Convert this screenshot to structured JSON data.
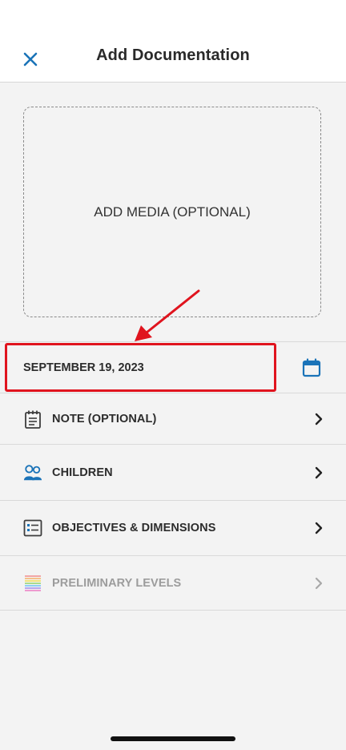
{
  "header": {
    "title": "Add Documentation",
    "close_icon": "close-icon"
  },
  "media": {
    "label": "ADD MEDIA (OPTIONAL)"
  },
  "date_row": {
    "value": "SEPTEMBER 19, 2023",
    "icon": "calendar-icon"
  },
  "rows": [
    {
      "label": "NOTE (OPTIONAL)",
      "icon": "note-icon",
      "disabled": false
    },
    {
      "label": "CHILDREN",
      "icon": "children-icon",
      "disabled": false
    },
    {
      "label": "OBJECTIVES & DIMENSIONS",
      "icon": "objectives-icon",
      "disabled": false
    },
    {
      "label": "PRELIMINARY LEVELS",
      "icon": "levels-icon",
      "disabled": true
    }
  ],
  "colors": {
    "accent": "#1a73b8",
    "highlight": "#e0141e",
    "background": "#f3f3f3"
  }
}
